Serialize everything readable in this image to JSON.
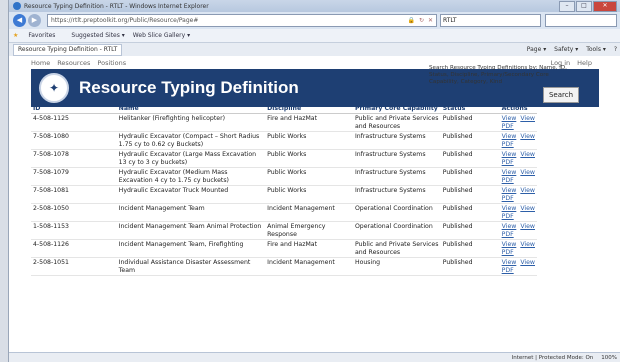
{
  "window": {
    "title": "Resource Typing Definition - RTLT - Windows Internet Explorer",
    "minimize": "–",
    "maximize": "□",
    "close": "✕"
  },
  "browser": {
    "address": "https://rtlt.preptoolkit.org/Public/Resource/Page#",
    "tab_title": "RTLT",
    "favorites_label": "Favorites",
    "fav_suggested": "Suggested Sites ▾",
    "fav_webslice": "Web Slice Gallery ▾",
    "page_tab": "Resource Typing Definition - RTLT",
    "cmd_page": "Page ▾",
    "cmd_safety": "Safety ▾",
    "cmd_tools": "Tools ▾"
  },
  "nav": {
    "home": "Home",
    "resources": "Resources",
    "positions": "Positions",
    "login": "Log in",
    "help": "Help"
  },
  "banner": {
    "title": "Resource Typing Definition"
  },
  "search": {
    "help": "Search Resource Typing Definitions by: Name, ID, Status, Discipline, Primary/Secondary Core Capability, Category, Kind",
    "button": "Search"
  },
  "table": {
    "headers": {
      "id": "ID",
      "name": "Name",
      "discipline": "Discipline",
      "capability": "Primary Core Capability",
      "status": "Status",
      "actions": "Actions"
    },
    "rows": [
      {
        "id": "4-508-1125",
        "name": "Helitanker (Firefighting helicopter)",
        "discipline": "Fire and HazMat",
        "capability": "Public and Private Services and Resources",
        "status": "Published",
        "view": "View",
        "pdf": "View PDF"
      },
      {
        "id": "7-508-1080",
        "name": "Hydraulic Excavator (Compact – Short Radius 1.75 cy to 0.62 cy Buckets)",
        "discipline": "Public Works",
        "capability": "Infrastructure Systems",
        "status": "Published",
        "view": "View",
        "pdf": "View PDF"
      },
      {
        "id": "7-508-1078",
        "name": "Hydraulic Excavator (Large Mass Excavation 13 cy to 3 cy buckets)",
        "discipline": "Public Works",
        "capability": "Infrastructure Systems",
        "status": "Published",
        "view": "View",
        "pdf": "View PDF"
      },
      {
        "id": "7-508-1079",
        "name": "Hydraulic Excavator (Medium Mass Excavation 4 cy to 1.75 cy buckets)",
        "discipline": "Public Works",
        "capability": "Infrastructure Systems",
        "status": "Published",
        "view": "View",
        "pdf": "View PDF"
      },
      {
        "id": "7-508-1081",
        "name": "Hydraulic Excavator Truck Mounted",
        "discipline": "Public Works",
        "capability": "Infrastructure Systems",
        "status": "Published",
        "view": "View",
        "pdf": "View PDF"
      },
      {
        "id": "2-508-1050",
        "name": "Incident Management Team",
        "discipline": "Incident Management",
        "capability": "Operational Coordination",
        "status": "Published",
        "view": "View",
        "pdf": "View PDF"
      },
      {
        "id": "1-508-1153",
        "name": "Incident Management Team Animal Protection",
        "discipline": "Animal Emergency Response",
        "capability": "Operational Coordination",
        "status": "Published",
        "view": "View",
        "pdf": "View PDF"
      },
      {
        "id": "4-508-1126",
        "name": "Incident Management Team, Firefighting",
        "discipline": "Fire and HazMat",
        "capability": "Public and Private Services and Resources",
        "status": "Published",
        "view": "View",
        "pdf": "View PDF"
      },
      {
        "id": "2-508-1051",
        "name": "Individual Assistance Disaster Assessment Team",
        "discipline": "Incident Management",
        "capability": "Housing",
        "status": "Published",
        "view": "View",
        "pdf": "View PDF"
      }
    ]
  },
  "statusbar": {
    "zone": "Internet | Protected Mode: On",
    "zoom": "100%"
  }
}
